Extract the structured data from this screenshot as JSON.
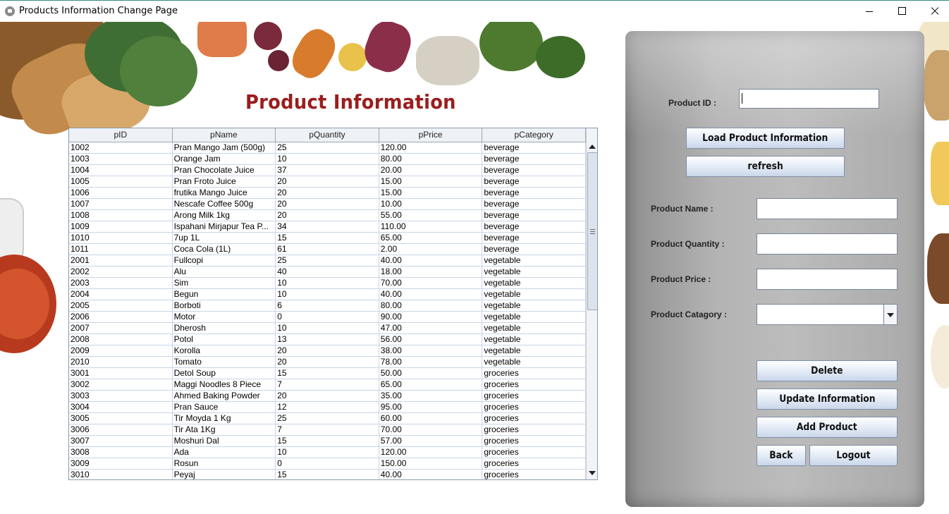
{
  "window": {
    "title": "Products Information Change Page"
  },
  "heading": "Product Information",
  "table": {
    "columns": [
      "pID",
      "pName",
      "pQuantity",
      "pPrice",
      "pCategory"
    ],
    "rows": [
      [
        "1002",
        "Pran Mango Jam (500g)",
        "25",
        "120.00",
        "beverage"
      ],
      [
        "1003",
        "Orange Jam",
        "10",
        "80.00",
        "beverage"
      ],
      [
        "1004",
        "Pran Chocolate Juice",
        "37",
        "20.00",
        "beverage"
      ],
      [
        "1005",
        "Pran Froto Juice",
        "20",
        "15.00",
        "beverage"
      ],
      [
        "1006",
        "frutika Mango Juice",
        "20",
        "15.00",
        "beverage"
      ],
      [
        "1007",
        "Nescafe Coffee 500g",
        "20",
        "10.00",
        "beverage"
      ],
      [
        "1008",
        "Arong Milk 1kg",
        "20",
        "55.00",
        "beverage"
      ],
      [
        "1009",
        "Ispahani Mirjapur Tea P...",
        "34",
        "110.00",
        "beverage"
      ],
      [
        "1010",
        "7up 1L",
        "15",
        "65.00",
        "beverage"
      ],
      [
        "1011",
        "Coca Cola (1L)",
        "61",
        "2.00",
        "beverage"
      ],
      [
        "2001",
        "Fullcopi",
        "25",
        "40.00",
        "vegetable"
      ],
      [
        "2002",
        "Alu",
        "40",
        "18.00",
        "vegetable"
      ],
      [
        "2003",
        "Sim",
        "10",
        "70.00",
        "vegetable"
      ],
      [
        "2004",
        "Begun",
        "10",
        "40.00",
        "vegetable"
      ],
      [
        "2005",
        "Borboti",
        "6",
        "80.00",
        "vegetable"
      ],
      [
        "2006",
        "Motor",
        "0",
        "90.00",
        "vegetable"
      ],
      [
        "2007",
        "Dherosh",
        "10",
        "47.00",
        "vegetable"
      ],
      [
        "2008",
        "Potol",
        "13",
        "56.00",
        "vegetable"
      ],
      [
        "2009",
        "Korolla",
        "20",
        "38.00",
        "vegetable"
      ],
      [
        "2010",
        "Tomato",
        "20",
        "78.00",
        "vegetable"
      ],
      [
        "3001",
        "Detol Soup",
        "15",
        "50.00",
        "groceries"
      ],
      [
        "3002",
        "Maggi Noodles 8 Piece",
        "7",
        "65.00",
        "groceries"
      ],
      [
        "3003",
        "Ahmed Baking Powder",
        "20",
        "35.00",
        "groceries"
      ],
      [
        "3004",
        "Pran Sauce",
        "12",
        "95.00",
        "groceries"
      ],
      [
        "3005",
        "Tir Moyda 1 Kg",
        "25",
        "60.00",
        "groceries"
      ],
      [
        "3006",
        "Tir Ata 1Kg",
        "7",
        "70.00",
        "groceries"
      ],
      [
        "3007",
        "Moshuri Dal",
        "15",
        "57.00",
        "groceries"
      ],
      [
        "3008",
        "Ada",
        "10",
        "120.00",
        "groceries"
      ],
      [
        "3009",
        "Rosun",
        "0",
        "150.00",
        "groceries"
      ],
      [
        "3010",
        "Peyaj",
        "15",
        "40.00",
        "groceries"
      ]
    ]
  },
  "form": {
    "product_id_label": "Product ID :",
    "product_id_value": "",
    "load_button": "Load Product Information",
    "refresh_button": "refresh",
    "name_label": "Product Name :",
    "name_value": "",
    "quantity_label": "Product Quantity :",
    "quantity_value": "",
    "price_label": "Product Price :",
    "price_value": "",
    "category_label": "Product Catagory :",
    "category_value": "",
    "delete_button": "Delete",
    "update_button": "Update Information",
    "add_button": "Add Product",
    "back_button": "Back",
    "logout_button": "Logout"
  },
  "colors": {
    "heading": "#9b1d1d",
    "panel": "#b3b3b3",
    "button_top": "#ffffff",
    "button_bottom": "#c9d7ea"
  },
  "icons": [
    "app-icon",
    "minimize-icon",
    "maximize-icon",
    "close-icon",
    "scroll-up-arrow-icon",
    "scroll-down-arrow-icon",
    "dropdown-arrow-icon"
  ]
}
